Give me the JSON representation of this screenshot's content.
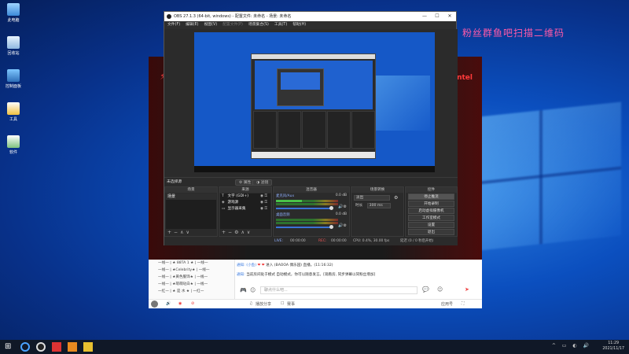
{
  "desktop": {
    "icons": [
      {
        "label": "此电脑",
        "icon": "computer-icon"
      },
      {
        "label": "回收站",
        "icon": "recycle-bin-icon"
      },
      {
        "label": "控制面板",
        "icon": "control-panel-icon"
      },
      {
        "label": "工具",
        "icon": "tools-icon"
      },
      {
        "label": "软件",
        "icon": "software-icon"
      }
    ],
    "overlay_text": "粉丝群鱼吧扫描二维码",
    "accent_color": "#ff5aa8"
  },
  "obs": {
    "title": "OBS 27.1.3 (64-bit, windows) - 配置文件: 未命名 - 场景: 未命名",
    "menu": [
      "文件(F)",
      "编辑(E)",
      "视图(V)",
      "配置文件(P)",
      "场景集合(S)",
      "工具(T)",
      "帮助(H)"
    ],
    "window_buttons": [
      "—",
      "☐",
      "✕"
    ],
    "scene_bar": {
      "current": "未选择源",
      "properties": "属性",
      "filters": "滤镜"
    },
    "docks": {
      "scenes": {
        "header": "场景",
        "items": [
          "场景"
        ],
        "footer_buttons": [
          "+",
          "−",
          "∧",
          "∨"
        ]
      },
      "sources": {
        "header": "来源",
        "items": [
          {
            "label": "文字 (GDI+)",
            "icon": "text-icon"
          },
          {
            "label": "游戏源",
            "icon": "game-icon"
          },
          {
            "label": "显示器采集",
            "icon": "monitor-icon"
          }
        ],
        "footer_buttons": [
          "+",
          "−",
          "⚙",
          "∧",
          "∨"
        ]
      },
      "mixer": {
        "header": "混音器",
        "channels": [
          {
            "name": "麦克风/Aux",
            "db": "0.0 dB"
          },
          {
            "name": "桌面音频",
            "db": "0.0 dB"
          }
        ]
      },
      "transitions": {
        "header": "场景转换",
        "type": "淡出",
        "duration_label": "时长",
        "duration_value": "300 ms"
      },
      "controls": {
        "header": "控件",
        "buttons": [
          "停止推流",
          "开始录制",
          "启动虚拟摄像机",
          "工作室模式",
          "设置",
          "退出"
        ]
      }
    },
    "status": {
      "live_label": "LIVE:",
      "live_time": "00:00:00",
      "rec_label": "REC:",
      "rec_time": "00:00:00",
      "cpu": "CPU: 0.4%, 30.00 fps",
      "dropped": "延迟 (0 / 0 秒后开始)"
    }
  },
  "live_room": {
    "right_mark": "intel",
    "chat_list": [
      "一线一 | ★ 88TA 1 ★ | 一线一",
      "一线一 | ★Celebrity★ | 一线一",
      "一线一 | ★黄色服饰★ | 一线一",
      "一线一 | ★萌萌哒白★ | 一线一",
      "一红一 | ★ 是 水 ★ | 一红一"
    ],
    "messages": [
      {
        "prefix": "通知:",
        "user": "(小鱼)",
        "text": "进入 (BAOOA 偶乐园) 直播。(11:16:32)"
      },
      {
        "prefix": "通知:",
        "user": "",
        "text": "当前房间处于模式 自动模式，你可以随意发言。[观看房, 同步弹幕以同粉丝增加]"
      }
    ],
    "input_placeholder": "聊点什么吧...",
    "bottom_bar": {
      "share": "播放分享",
      "gift": "赛事",
      "fullscreen": "应用号"
    }
  },
  "taskbar": {
    "time": "11:29",
    "date": "2021/11/17",
    "apps": [
      "windows-start-icon",
      "search-icon",
      "obs-icon",
      "live-app-icon",
      "orange-app-icon",
      "yellow-app-icon"
    ]
  }
}
